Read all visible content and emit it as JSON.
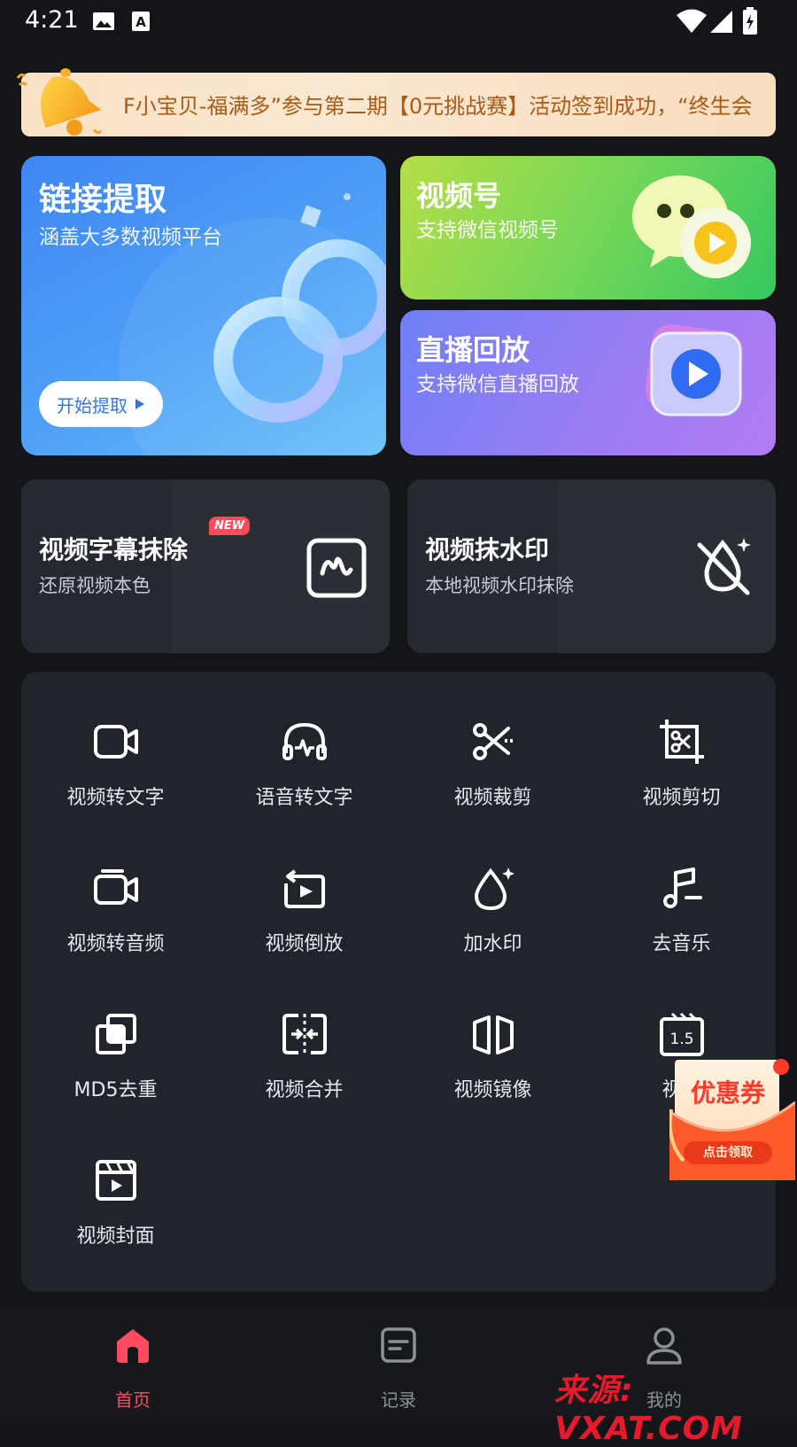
{
  "status_bar": {
    "time": "4:21",
    "left_icons": [
      "image-icon",
      "text-a-icon"
    ],
    "right_icons": [
      "wifi-icon",
      "signal-icon",
      "battery-icon"
    ]
  },
  "notice": {
    "text": "F小宝贝-福满多”参与第二期【0元挑战赛】活动签到成功，“终生会",
    "icon": "bell-icon"
  },
  "cards": {
    "link_extract": {
      "title": "链接提取",
      "subtitle": "涵盖大多数视频平台",
      "button": "开始提取"
    },
    "channels": {
      "title": "视频号",
      "subtitle": "支持微信视频号"
    },
    "live_replay": {
      "title": "直播回放",
      "subtitle": "支持微信直播回放"
    }
  },
  "features": {
    "subtitle_remove": {
      "title": "视频字幕抹除",
      "subtitle": "还原视频本色",
      "badge": "NEW"
    },
    "watermark_remove": {
      "title": "视频抹水印",
      "subtitle": "本地视频水印抹除"
    }
  },
  "tools": [
    {
      "label": "视频转文字",
      "icon": "video-camera-icon"
    },
    {
      "label": "语音转文字",
      "icon": "headphones-icon"
    },
    {
      "label": "视频裁剪",
      "icon": "scissors-icon"
    },
    {
      "label": "视频剪切",
      "icon": "crop-cut-icon"
    },
    {
      "label": "视频转音频",
      "icon": "video-audio-icon"
    },
    {
      "label": "视频倒放",
      "icon": "rewind-play-icon"
    },
    {
      "label": "加水印",
      "icon": "water-drop-icon"
    },
    {
      "label": "去音乐",
      "icon": "music-remove-icon"
    },
    {
      "label": "MD5去重",
      "icon": "layers-icon"
    },
    {
      "label": "视频合并",
      "icon": "merge-icon"
    },
    {
      "label": "视频镜像",
      "icon": "mirror-icon"
    },
    {
      "label": "视频",
      "icon": "speed-icon"
    },
    {
      "label": "视频封面",
      "icon": "clapper-icon"
    }
  ],
  "coupon": {
    "title": "优惠券",
    "button": "点击领取"
  },
  "bottom_nav": [
    {
      "label": "首页",
      "icon": "home-icon",
      "active": true
    },
    {
      "label": "记录",
      "icon": "record-icon",
      "active": false
    },
    {
      "label": "我的",
      "icon": "profile-icon",
      "active": false
    }
  ],
  "watermark_text": "来源: VXAT.COM",
  "colors": {
    "accent": "#ff4b5f",
    "background": "#141518",
    "panel": "#22242b"
  }
}
